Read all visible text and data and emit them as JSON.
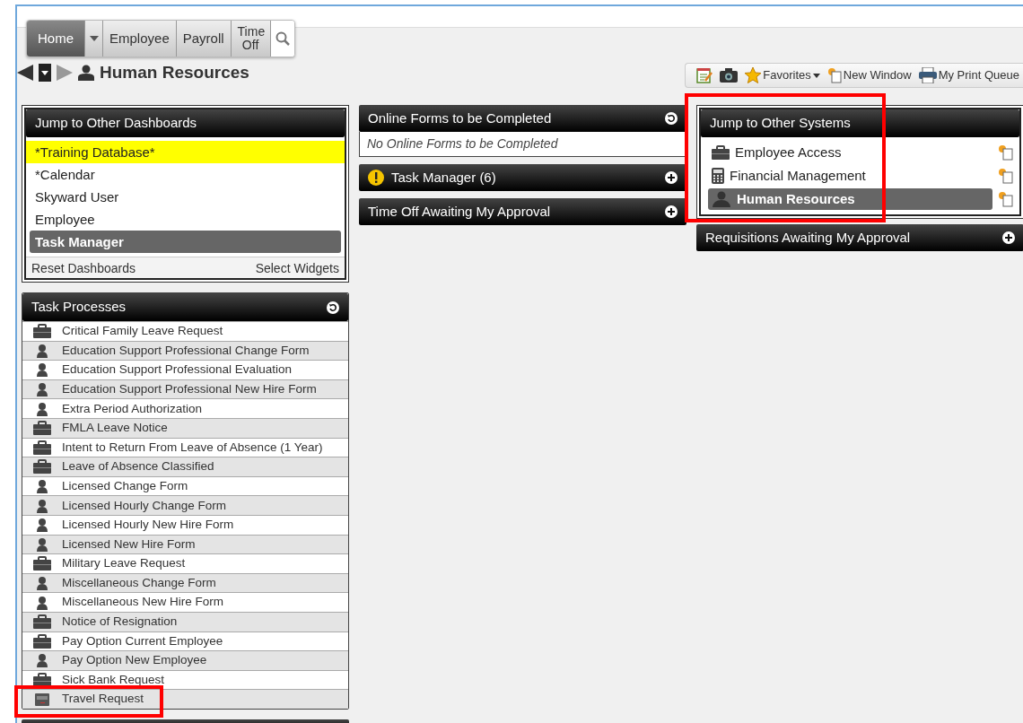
{
  "nav": {
    "tabs": [
      {
        "label": "Home",
        "selected": true
      },
      {
        "label": "Employee",
        "selected": false
      },
      {
        "label": "Payroll",
        "selected": false
      },
      {
        "label": "Time Off",
        "selected": false
      }
    ]
  },
  "page_title": "Human Resources",
  "toolbar": [
    {
      "kind": "notes"
    },
    {
      "kind": "camera"
    },
    {
      "kind": "favorites",
      "label": "Favorites"
    },
    {
      "kind": "new-window",
      "label": "New Window"
    },
    {
      "kind": "print",
      "label": "My Print Queue"
    }
  ],
  "dashboards": {
    "title": "Jump to Other Dashboards",
    "items": [
      {
        "label": "*Training Database*",
        "selected": false,
        "highlighted": true
      },
      {
        "label": "*Calendar",
        "selected": false,
        "highlighted": false
      },
      {
        "label": "Skyward User",
        "selected": false,
        "highlighted": false
      },
      {
        "label": "Employee",
        "selected": false,
        "highlighted": false
      },
      {
        "label": "Task Manager",
        "selected": true,
        "highlighted": false
      }
    ],
    "footer": [
      "Reset Dashboards",
      "Select Widgets"
    ]
  },
  "task_processes": {
    "title": "Task Processes",
    "items": [
      {
        "label": "Critical Family Leave Request",
        "kind": "briefcase",
        "annotated": false
      },
      {
        "label": "Education Support Professional Change Form",
        "kind": "person",
        "annotated": false
      },
      {
        "label": "Education Support Professional Evaluation",
        "kind": "person",
        "annotated": false
      },
      {
        "label": "Education Support Professional New Hire Form",
        "kind": "person",
        "annotated": false
      },
      {
        "label": "Extra Period Authorization",
        "kind": "person",
        "annotated": false
      },
      {
        "label": "FMLA Leave Notice",
        "kind": "briefcase",
        "annotated": false
      },
      {
        "label": "Intent to Return From Leave of Absence (1 Year)",
        "kind": "briefcase",
        "annotated": false
      },
      {
        "label": "Leave of Absence Classified",
        "kind": "briefcase",
        "annotated": false
      },
      {
        "label": "Licensed Change Form",
        "kind": "person",
        "annotated": false
      },
      {
        "label": "Licensed Hourly Change Form",
        "kind": "person",
        "annotated": false
      },
      {
        "label": "Licensed Hourly New Hire Form",
        "kind": "person",
        "annotated": false
      },
      {
        "label": "Licensed New Hire Form",
        "kind": "person",
        "annotated": false
      },
      {
        "label": "Military Leave Request",
        "kind": "briefcase",
        "annotated": false
      },
      {
        "label": "Miscellaneous Change Form",
        "kind": "person",
        "annotated": false
      },
      {
        "label": "Miscellaneous New Hire Form",
        "kind": "person",
        "annotated": false
      },
      {
        "label": "Notice of Resignation",
        "kind": "briefcase",
        "annotated": false
      },
      {
        "label": "Pay Option Current Employee",
        "kind": "briefcase",
        "annotated": false
      },
      {
        "label": "Pay Option New Employee",
        "kind": "person",
        "annotated": false
      },
      {
        "label": "Sick Bank Request",
        "kind": "briefcase",
        "annotated": false
      },
      {
        "label": "Travel Request",
        "kind": "card",
        "annotated": true
      }
    ]
  },
  "middle_panels": [
    {
      "title": "Online Forms to be Completed",
      "kind": "refresh",
      "alert": false,
      "empty_text": "No Online Forms to be Completed"
    },
    {
      "title": "Task Manager (6)",
      "kind": "expand",
      "alert": true
    },
    {
      "title": "Time Off Awaiting My Approval",
      "kind": "expand",
      "alert": false
    }
  ],
  "systems": {
    "title": "Jump to Other Systems",
    "annotated": true,
    "items": [
      {
        "label": "Employee Access",
        "kind": "briefcase",
        "selected": false
      },
      {
        "label": "Financial Management",
        "kind": "calculator",
        "selected": false
      },
      {
        "label": "Human Resources",
        "kind": "person",
        "selected": true
      }
    ]
  },
  "right_panels": [
    {
      "title": "Requisitions Awaiting My Approval",
      "kind": "expand",
      "alert": false
    }
  ]
}
